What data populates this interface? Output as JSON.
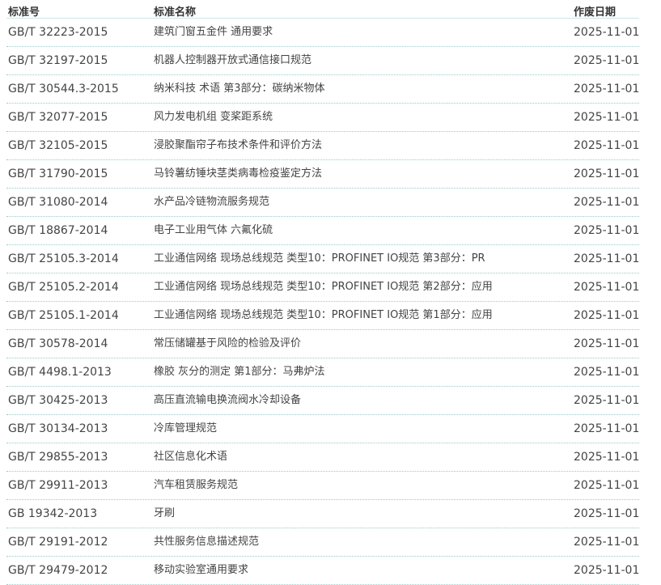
{
  "table": {
    "headers": {
      "code": "标准号",
      "name": "标准名称",
      "date": "作废日期"
    },
    "rows": [
      {
        "code": "GB/T 32223-2015",
        "name": "建筑门窗五金件 通用要求",
        "date": "2025-11-01"
      },
      {
        "code": "GB/T 32197-2015",
        "name": "机器人控制器开放式通信接口规范",
        "date": "2025-11-01"
      },
      {
        "code": "GB/T 30544.3-2015",
        "name": "纳米科技 术语 第3部分：碳纳米物体",
        "date": "2025-11-01"
      },
      {
        "code": "GB/T 32077-2015",
        "name": "风力发电机组 变桨距系统",
        "date": "2025-11-01"
      },
      {
        "code": "GB/T 32105-2015",
        "name": "浸胶聚酯帘子布技术条件和评价方法",
        "date": "2025-11-01"
      },
      {
        "code": "GB/T 31790-2015",
        "name": "马铃薯纺锤块茎类病毒检疫鉴定方法",
        "date": "2025-11-01"
      },
      {
        "code": "GB/T 31080-2014",
        "name": "水产品冷链物流服务规范",
        "date": "2025-11-01"
      },
      {
        "code": "GB/T 18867-2014",
        "name": "电子工业用气体 六氟化硫",
        "date": "2025-11-01"
      },
      {
        "code": "GB/T 25105.3-2014",
        "name": "工业通信网络 现场总线规范 类型10：PROFINET IO规范 第3部分：PR",
        "date": "2025-11-01"
      },
      {
        "code": "GB/T 25105.2-2014",
        "name": "工业通信网络 现场总线规范 类型10：PROFINET IO规范 第2部分：应用",
        "date": "2025-11-01"
      },
      {
        "code": "GB/T 25105.1-2014",
        "name": "工业通信网络 现场总线规范 类型10：PROFINET IO规范 第1部分：应用",
        "date": "2025-11-01"
      },
      {
        "code": "GB/T 30578-2014",
        "name": "常压储罐基于风险的检验及评价",
        "date": "2025-11-01"
      },
      {
        "code": "GB/T 4498.1-2013",
        "name": "橡胶 灰分的测定 第1部分：马弗炉法",
        "date": "2025-11-01"
      },
      {
        "code": "GB/T 30425-2013",
        "name": "高压直流输电换流阀水冷却设备",
        "date": "2025-11-01"
      },
      {
        "code": "GB/T 30134-2013",
        "name": "冷库管理规范",
        "date": "2025-11-01"
      },
      {
        "code": "GB/T 29855-2013",
        "name": "社区信息化术语",
        "date": "2025-11-01"
      },
      {
        "code": "GB/T 29911-2013",
        "name": "汽车租赁服务规范",
        "date": "2025-11-01"
      },
      {
        "code": "GB 19342-2013",
        "name": "牙刷",
        "date": "2025-11-01"
      },
      {
        "code": "GB/T 29191-2012",
        "name": "共性服务信息描述规范",
        "date": "2025-11-01"
      },
      {
        "code": "GB/T 29479-2012",
        "name": "移动实验室通用要求",
        "date": "2025-11-01"
      }
    ]
  },
  "colors": {
    "row_divider": "#9cc9c9",
    "text": "#444444"
  }
}
